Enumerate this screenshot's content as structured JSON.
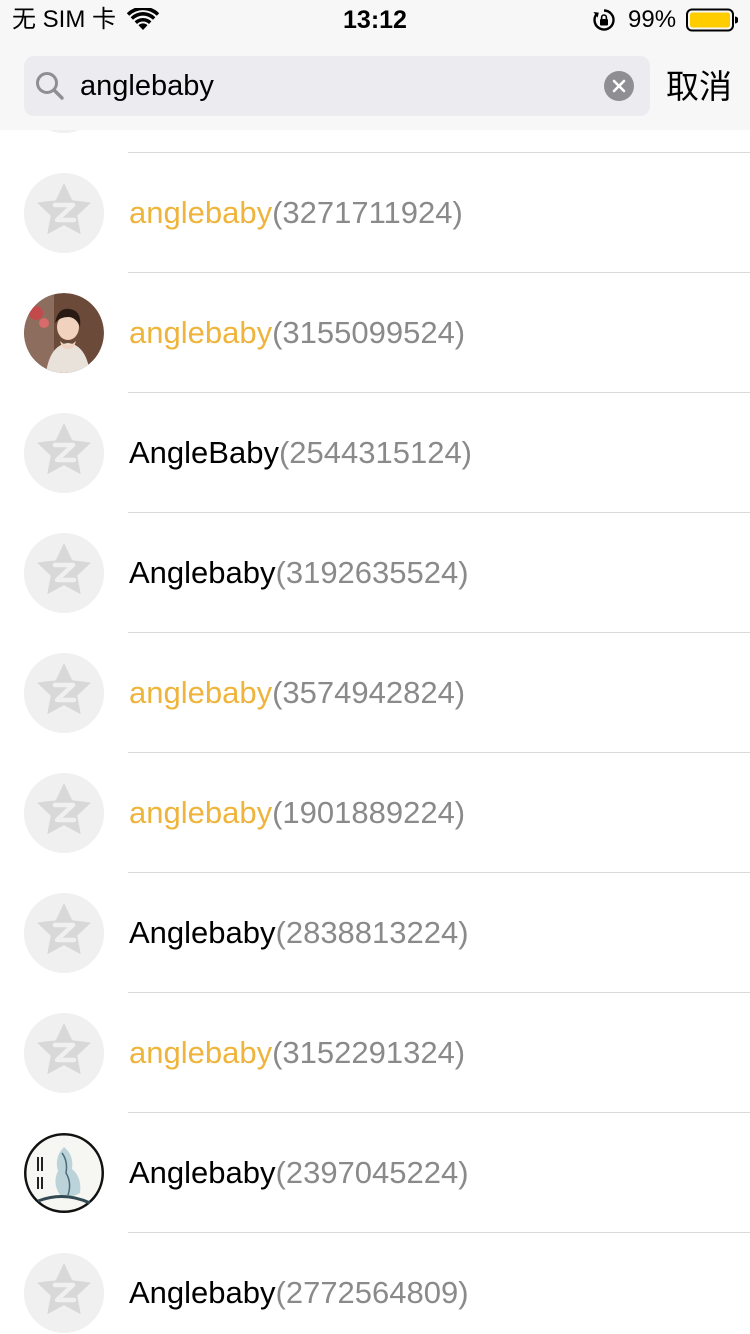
{
  "status_bar": {
    "carrier": "无 SIM 卡",
    "time": "13:12",
    "battery": "99%"
  },
  "search": {
    "query": "anglebaby",
    "cancel_label": "取消"
  },
  "colors": {
    "highlight": "#eeb43c",
    "qq_number": "#8a8a8a",
    "battery": "#ffcc00"
  },
  "results": [
    {
      "name": "",
      "qq": "",
      "avatar": "default-avatar-icon"
    },
    {
      "name": "anglebaby",
      "qq": "(3271711924)",
      "highlight": true,
      "avatar": "default-avatar-icon"
    },
    {
      "name": "anglebaby",
      "qq": "(3155099524)",
      "highlight": true,
      "avatar": "photo-avatar"
    },
    {
      "name": "AngleBaby",
      "qq": "(2544315124)",
      "highlight": false,
      "avatar": "default-avatar-icon"
    },
    {
      "name": "Anglebaby",
      "qq": "(3192635524)",
      "highlight": false,
      "avatar": "default-avatar-icon"
    },
    {
      "name": "anglebaby",
      "qq": "(3574942824)",
      "highlight": true,
      "avatar": "default-avatar-icon"
    },
    {
      "name": "anglebaby",
      "qq": "(1901889224)",
      "highlight": true,
      "avatar": "default-avatar-icon"
    },
    {
      "name": "Anglebaby",
      "qq": "(2838813224)",
      "highlight": false,
      "avatar": "default-avatar-icon"
    },
    {
      "name": "anglebaby",
      "qq": "(3152291324)",
      "highlight": true,
      "avatar": "default-avatar-icon"
    },
    {
      "name": "Anglebaby",
      "qq": "(2397045224)",
      "highlight": false,
      "avatar": "painting-avatar"
    },
    {
      "name": "Anglebaby",
      "qq": "(2772564809)",
      "highlight": false,
      "avatar": "default-avatar-icon"
    }
  ]
}
